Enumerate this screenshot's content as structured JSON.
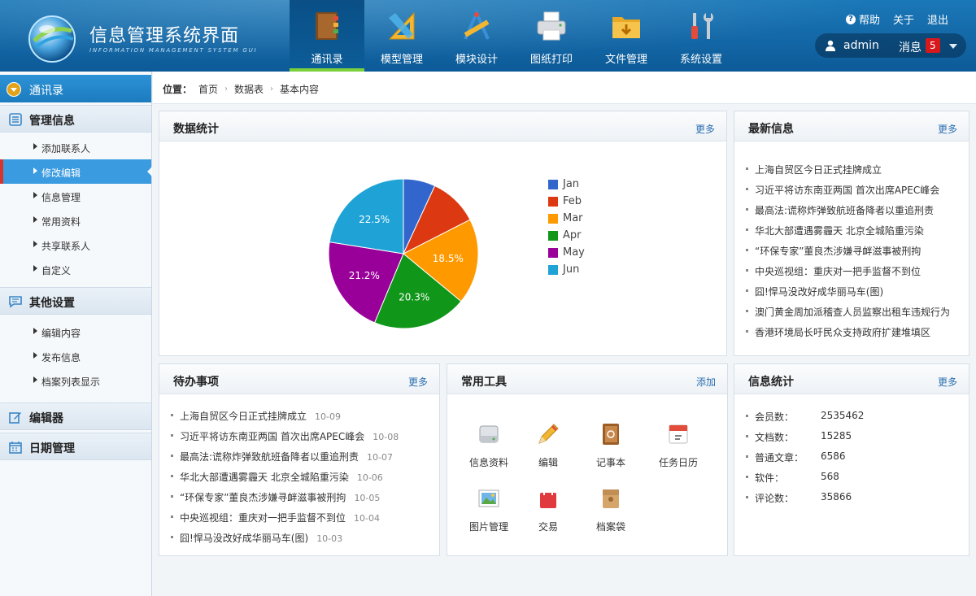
{
  "app": {
    "title": "信息管理系统界面",
    "subtitle": "INFORMATION MANAGEMENT SYSTEM GUI"
  },
  "nav": [
    {
      "label": "通讯录",
      "icon": "address-book-icon",
      "active": true
    },
    {
      "label": "模型管理",
      "icon": "triangle-ruler-icon"
    },
    {
      "label": "模块设计",
      "icon": "design-tools-icon"
    },
    {
      "label": "图纸打印",
      "icon": "printer-icon"
    },
    {
      "label": "文件管理",
      "icon": "folder-icon"
    },
    {
      "label": "系统设置",
      "icon": "wrench-screwdriver-icon"
    }
  ],
  "top_links": {
    "help": "帮助",
    "about": "关于",
    "logout": "退出"
  },
  "user": {
    "name": "admin",
    "messages_label": "消息",
    "message_count": "5"
  },
  "sidebar": {
    "active_section": "通讯录",
    "groups": [
      {
        "label": "管理信息",
        "icon": "list-icon",
        "items": [
          "添加联系人",
          "修改编辑",
          "信息管理",
          "常用资料",
          "共享联系人",
          "自定义"
        ],
        "selected_index": 1
      },
      {
        "label": "其他设置",
        "icon": "chat-icon",
        "items": [
          "编辑内容",
          "发布信息",
          "档案列表显示"
        ]
      },
      {
        "label": "编辑器",
        "icon": "edit-icon",
        "items": []
      },
      {
        "label": "日期管理",
        "icon": "calendar-icon",
        "items": []
      }
    ]
  },
  "breadcrumb": {
    "lead": "位置：",
    "items": [
      "首页",
      "数据表",
      "基本内容"
    ],
    "sep": "›"
  },
  "panels": {
    "stats_chart": {
      "title": "数据统计",
      "more": "更多"
    },
    "latest": {
      "title": "最新信息",
      "more": "更多",
      "items": [
        "上海自贸区今日正式挂牌成立",
        "习近平将访东南亚两国 首次出席APEC峰会",
        "最高法:谎称炸弹致航班备降者以重追刑责",
        "华北大部遭遇雾霾天 北京全城陷重污染",
        "“环保专家”董良杰涉嫌寻衅滋事被刑拘",
        "中央巡视组：重庆对一把手监督不到位",
        "囧!悍马没改好成华丽马车(图)",
        "澳门黄金周加派稽查人员监察出租车违规行为",
        "香港环境局长吁民众支持政府扩建堆填区"
      ]
    },
    "todo": {
      "title": "待办事项",
      "more": "更多",
      "items": [
        {
          "text": "上海自贸区今日正式挂牌成立",
          "date": "10-09"
        },
        {
          "text": "习近平将访东南亚两国 首次出席APEC峰会",
          "date": "10-08"
        },
        {
          "text": "最高法:谎称炸弹致航班备降者以重追刑责",
          "date": "10-07"
        },
        {
          "text": "华北大部遭遇雾霾天 北京全城陷重污染",
          "date": "10-06"
        },
        {
          "text": "“环保专家”董良杰涉嫌寻衅滋事被刑拘",
          "date": "10-05"
        },
        {
          "text": "中央巡视组：重庆对一把手监督不到位",
          "date": "10-04"
        },
        {
          "text": "囧!悍马没改好成华丽马车(图)",
          "date": "10-03"
        }
      ]
    },
    "tools": {
      "title": "常用工具",
      "add": "添加",
      "items": [
        {
          "label": "信息资料",
          "icon": "drive-icon"
        },
        {
          "label": "编辑",
          "icon": "pencil-icon"
        },
        {
          "label": "记事本",
          "icon": "notebook-icon"
        },
        {
          "label": "任务日历",
          "icon": "calendar-icon"
        },
        {
          "label": "图片管理",
          "icon": "picture-icon"
        },
        {
          "label": "交易",
          "icon": "shopping-bag-icon"
        },
        {
          "label": "档案袋",
          "icon": "archive-bag-icon"
        }
      ]
    },
    "info_stats": {
      "title": "信息统计",
      "more": "更多",
      "items": [
        {
          "label": "会员数：",
          "value": "2535462"
        },
        {
          "label": "文档数：",
          "value": "15285"
        },
        {
          "label": "普通文章：",
          "value": "6586"
        },
        {
          "label": "软件：",
          "value": "568"
        },
        {
          "label": "评论数：",
          "value": "35866"
        }
      ]
    }
  },
  "chart_data": {
    "type": "pie",
    "title": "",
    "categories": [
      "Jan",
      "Feb",
      "Mar",
      "Apr",
      "May",
      "Jun"
    ],
    "values": [
      6.9,
      10.6,
      18.5,
      20.3,
      21.2,
      22.5
    ],
    "labels_shown": [
      "",
      "",
      "18.5%",
      "20.3%",
      "21.2%",
      "22.5%"
    ],
    "colors": [
      "#3366cc",
      "#dc3912",
      "#ff9900",
      "#109618",
      "#990099",
      "#1fa3d6"
    ],
    "legend": "right"
  }
}
